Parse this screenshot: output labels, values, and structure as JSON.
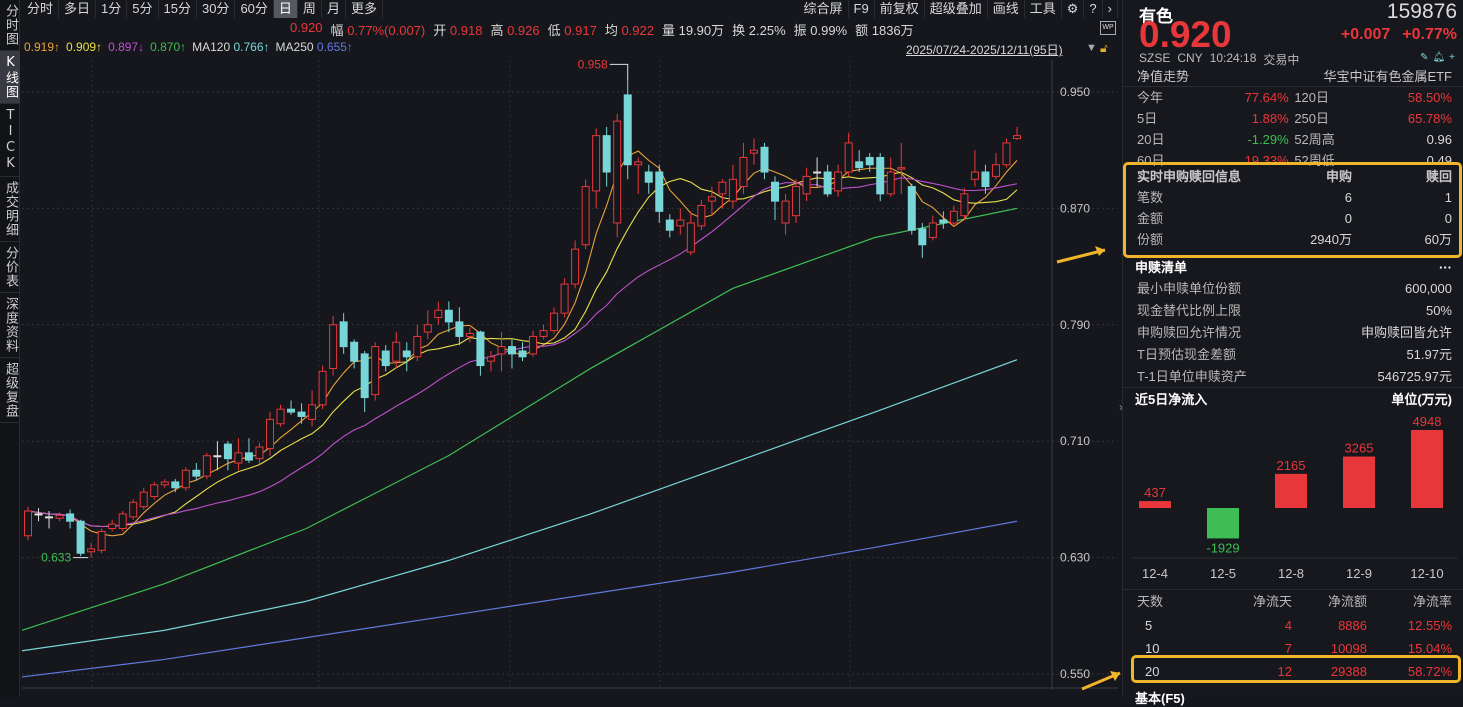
{
  "sidebar": {
    "tabs": [
      "分时图",
      "K线图",
      "TICK",
      "成交明细",
      "分价表",
      "深度资料",
      "超级复盘"
    ],
    "selected": "K线图"
  },
  "toolbar": {
    "periods": [
      "分时",
      "多日",
      "1分",
      "5分",
      "15分",
      "30分",
      "60分",
      "日",
      "周",
      "月",
      "更多"
    ],
    "selected": "日",
    "right": [
      "综合屏",
      "F9",
      "前复权",
      "超级叠加",
      "画线",
      "工具"
    ],
    "icons": [
      "gear-icon",
      "help-icon",
      "chevron-right-icon"
    ]
  },
  "quote_line": {
    "price": "0.920",
    "fu_label": "幅",
    "fu": "0.77%(0.007)",
    "kai_label": "开",
    "kai": "0.918",
    "gao_label": "高",
    "gao": "0.926",
    "di_label": "低",
    "di": "0.917",
    "jun_label": "均",
    "jun": "0.922",
    "liang": "量 19.90万",
    "huan": "换 2.25%",
    "zhen": "振 0.99%",
    "e": "额 1836万"
  },
  "ma_legend": [
    {
      "value": "0.919↑",
      "color": "#e8a23a"
    },
    {
      "value": "0.909↑",
      "color": "#e8e04a"
    },
    {
      "value": "0.897↓",
      "color": "#c050d0"
    },
    {
      "value": "0.870↑",
      "color": "#3dbd54"
    },
    {
      "label": "MA120",
      "value": "0.766↑",
      "color": "#79d6d8"
    },
    {
      "label": "MA250",
      "value": "0.655↑",
      "color": "#6079e0"
    }
  ],
  "date_range": "2025/07/24-2025/12/11(95日)",
  "chart_data": {
    "type": "candlestick",
    "yticks": [
      "0.950",
      "0.870",
      "0.790",
      "0.710",
      "0.630",
      "0.550"
    ],
    "ylim": [
      0.55,
      0.95
    ],
    "max_label": "0.958",
    "min_label": "0.633",
    "colors": {
      "up": "#e8373a",
      "down": "#79d6d8",
      "ma5": "#e8a23a",
      "ma10": "#e8e04a",
      "ma20": "#c050d0",
      "ma60": "#3dbd54",
      "ma120": "#79d6d8",
      "ma250": "#6079e0"
    },
    "candles_ohlc": [
      [
        0.645,
        0.665,
        0.642,
        0.662
      ],
      [
        0.66,
        0.664,
        0.655,
        0.66
      ],
      [
        0.658,
        0.662,
        0.65,
        0.658
      ],
      [
        0.657,
        0.661,
        0.655,
        0.659
      ],
      [
        0.66,
        0.663,
        0.65,
        0.655
      ],
      [
        0.655,
        0.656,
        0.631,
        0.633
      ],
      [
        0.634,
        0.64,
        0.63,
        0.636
      ],
      [
        0.635,
        0.65,
        0.633,
        0.648
      ],
      [
        0.65,
        0.656,
        0.648,
        0.653
      ],
      [
        0.65,
        0.662,
        0.648,
        0.66
      ],
      [
        0.658,
        0.67,
        0.656,
        0.668
      ],
      [
        0.665,
        0.678,
        0.663,
        0.675
      ],
      [
        0.672,
        0.682,
        0.67,
        0.68
      ],
      [
        0.68,
        0.684,
        0.678,
        0.682
      ],
      [
        0.682,
        0.684,
        0.675,
        0.678
      ],
      [
        0.678,
        0.692,
        0.676,
        0.69
      ],
      [
        0.69,
        0.695,
        0.683,
        0.686
      ],
      [
        0.686,
        0.702,
        0.684,
        0.7
      ],
      [
        0.7,
        0.71,
        0.69,
        0.7
      ],
      [
        0.708,
        0.71,
        0.69,
        0.698
      ],
      [
        0.695,
        0.712,
        0.69,
        0.702
      ],
      [
        0.702,
        0.712,
        0.695,
        0.697
      ],
      [
        0.698,
        0.709,
        0.694,
        0.706
      ],
      [
        0.705,
        0.73,
        0.7,
        0.725
      ],
      [
        0.722,
        0.735,
        0.72,
        0.732
      ],
      [
        0.732,
        0.738,
        0.728,
        0.73
      ],
      [
        0.73,
        0.736,
        0.722,
        0.727
      ],
      [
        0.725,
        0.745,
        0.72,
        0.735
      ],
      [
        0.735,
        0.762,
        0.732,
        0.758
      ],
      [
        0.76,
        0.796,
        0.755,
        0.79
      ],
      [
        0.792,
        0.798,
        0.77,
        0.775
      ],
      [
        0.778,
        0.78,
        0.76,
        0.765
      ],
      [
        0.77,
        0.772,
        0.73,
        0.74
      ],
      [
        0.742,
        0.778,
        0.738,
        0.775
      ],
      [
        0.772,
        0.776,
        0.758,
        0.762
      ],
      [
        0.765,
        0.785,
        0.76,
        0.778
      ],
      [
        0.772,
        0.778,
        0.758,
        0.768
      ],
      [
        0.768,
        0.79,
        0.765,
        0.782
      ],
      [
        0.785,
        0.8,
        0.78,
        0.79
      ],
      [
        0.795,
        0.806,
        0.79,
        0.8
      ],
      [
        0.8,
        0.806,
        0.785,
        0.792
      ],
      [
        0.792,
        0.802,
        0.776,
        0.782
      ],
      [
        0.782,
        0.788,
        0.778,
        0.784
      ],
      [
        0.785,
        0.786,
        0.755,
        0.762
      ],
      [
        0.765,
        0.772,
        0.758,
        0.768
      ],
      [
        0.77,
        0.785,
        0.758,
        0.775
      ],
      [
        0.775,
        0.78,
        0.76,
        0.77
      ],
      [
        0.772,
        0.778,
        0.765,
        0.768
      ],
      [
        0.77,
        0.786,
        0.768,
        0.782
      ],
      [
        0.782,
        0.79,
        0.78,
        0.786
      ],
      [
        0.786,
        0.802,
        0.784,
        0.798
      ],
      [
        0.798,
        0.822,
        0.795,
        0.818
      ],
      [
        0.818,
        0.848,
        0.815,
        0.842
      ],
      [
        0.845,
        0.89,
        0.842,
        0.885
      ],
      [
        0.882,
        0.925,
        0.87,
        0.92
      ],
      [
        0.92,
        0.926,
        0.885,
        0.895
      ],
      [
        0.86,
        0.935,
        0.85,
        0.93
      ],
      [
        0.948,
        0.958,
        0.89,
        0.9
      ],
      [
        0.9,
        0.905,
        0.88,
        0.902
      ],
      [
        0.895,
        0.9,
        0.88,
        0.888
      ],
      [
        0.895,
        0.9,
        0.86,
        0.868
      ],
      [
        0.862,
        0.866,
        0.85,
        0.855
      ],
      [
        0.858,
        0.87,
        0.852,
        0.862
      ],
      [
        0.84,
        0.868,
        0.838,
        0.86
      ],
      [
        0.858,
        0.876,
        0.855,
        0.872
      ],
      [
        0.875,
        0.885,
        0.865,
        0.878
      ],
      [
        0.88,
        0.89,
        0.87,
        0.888
      ],
      [
        0.875,
        0.9,
        0.87,
        0.89
      ],
      [
        0.885,
        0.915,
        0.88,
        0.905
      ],
      [
        0.908,
        0.918,
        0.9,
        0.91
      ],
      [
        0.912,
        0.915,
        0.89,
        0.895
      ],
      [
        0.888,
        0.892,
        0.862,
        0.875
      ],
      [
        0.86,
        0.88,
        0.852,
        0.875
      ],
      [
        0.865,
        0.89,
        0.86,
        0.885
      ],
      [
        0.88,
        0.898,
        0.875,
        0.892
      ],
      [
        0.895,
        0.905,
        0.885,
        0.895
      ],
      [
        0.895,
        0.9,
        0.878,
        0.88
      ],
      [
        0.882,
        0.9,
        0.878,
        0.895
      ],
      [
        0.895,
        0.922,
        0.892,
        0.915
      ],
      [
        0.902,
        0.91,
        0.895,
        0.898
      ],
      [
        0.905,
        0.908,
        0.895,
        0.9
      ],
      [
        0.905,
        0.908,
        0.875,
        0.88
      ],
      [
        0.88,
        0.905,
        0.878,
        0.895
      ],
      [
        0.897,
        0.915,
        0.88,
        0.898
      ],
      [
        0.885,
        0.887,
        0.852,
        0.855
      ],
      [
        0.856,
        0.86,
        0.836,
        0.845
      ],
      [
        0.85,
        0.865,
        0.848,
        0.86
      ],
      [
        0.862,
        0.868,
        0.856,
        0.86
      ],
      [
        0.86,
        0.872,
        0.858,
        0.868
      ],
      [
        0.865,
        0.884,
        0.862,
        0.88
      ],
      [
        0.89,
        0.91,
        0.885,
        0.895
      ],
      [
        0.895,
        0.9,
        0.88,
        0.885
      ],
      [
        0.892,
        0.908,
        0.89,
        0.9
      ],
      [
        0.9,
        0.918,
        0.898,
        0.915
      ],
      [
        0.918,
        0.926,
        0.917,
        0.92
      ]
    ],
    "long_ma": {
      "ma60": [
        0.58,
        0.612,
        0.65,
        0.7,
        0.76,
        0.815,
        0.85,
        0.87
      ],
      "ma120": [
        0.566,
        0.58,
        0.6,
        0.628,
        0.66,
        0.695,
        0.73,
        0.766
      ],
      "ma250": [
        0.548,
        0.56,
        0.575,
        0.59,
        0.605,
        0.62,
        0.637,
        0.655
      ]
    }
  },
  "right_panel": {
    "name": "有色",
    "code": "159876",
    "price": "0.920",
    "change": "+0.007",
    "change_pct": "+0.77%",
    "exchange": "SZSE",
    "currency": "CNY",
    "time": "10:24:18",
    "status": "交易中",
    "nav_title": "净值走势",
    "fund_name": "华宝中证有色金属ETF",
    "nav_rows": [
      {
        "l1": "今年",
        "v1": "77.64%",
        "l2": "120日",
        "v2": "58.50%"
      },
      {
        "l1": "5日",
        "v1": "1.88%",
        "l2": "250日",
        "v2": "65.78%"
      },
      {
        "l1": "20日",
        "v1": "-1.29%",
        "l2": "52周高",
        "v2": "0.96"
      },
      {
        "l1": "60日",
        "v1": "19.33%",
        "l2": "52周低",
        "v2": "0.49"
      }
    ],
    "realtime": {
      "title": "实时申购赎回信息",
      "col1": "申购",
      "col2": "赎回",
      "rows": [
        {
          "label": "笔数",
          "a": "6",
          "b": "1"
        },
        {
          "label": "金额",
          "a": "0",
          "b": "0"
        },
        {
          "label": "份额",
          "a": "2940万",
          "b": "60万"
        }
      ]
    },
    "list": {
      "title": "申赎清单",
      "more": "···",
      "rows": [
        {
          "label": "最小申赎单位份额",
          "value": "600,000"
        },
        {
          "label": "现金替代比例上限",
          "value": "50%"
        },
        {
          "label": "申购赎回允许情况",
          "value": "申购赎回皆允许"
        },
        {
          "label": "T日预估现金差额",
          "value": "51.97元"
        },
        {
          "label": "T-1日单位申赎资产",
          "value": "546725.97元"
        }
      ]
    },
    "flow": {
      "title": "近5日净流入",
      "unit": "单位(万元)",
      "chart_data": {
        "type": "bar",
        "categories": [
          "12-4",
          "12-5",
          "12-8",
          "12-9",
          "12-10"
        ],
        "values": [
          437,
          -1929,
          2165,
          3265,
          4948
        ],
        "colors": {
          "pos": "#e8373a",
          "neg": "#3dbd54"
        }
      }
    },
    "flow_table": {
      "headers": [
        "天数",
        "净流天",
        "净流额",
        "净流率"
      ],
      "rows": [
        [
          "5",
          "4",
          "8886",
          "12.55%"
        ],
        [
          "10",
          "7",
          "10098",
          "15.04%"
        ],
        [
          "20",
          "12",
          "29388",
          "58.72%"
        ]
      ]
    },
    "footer": "基本(F5)"
  }
}
